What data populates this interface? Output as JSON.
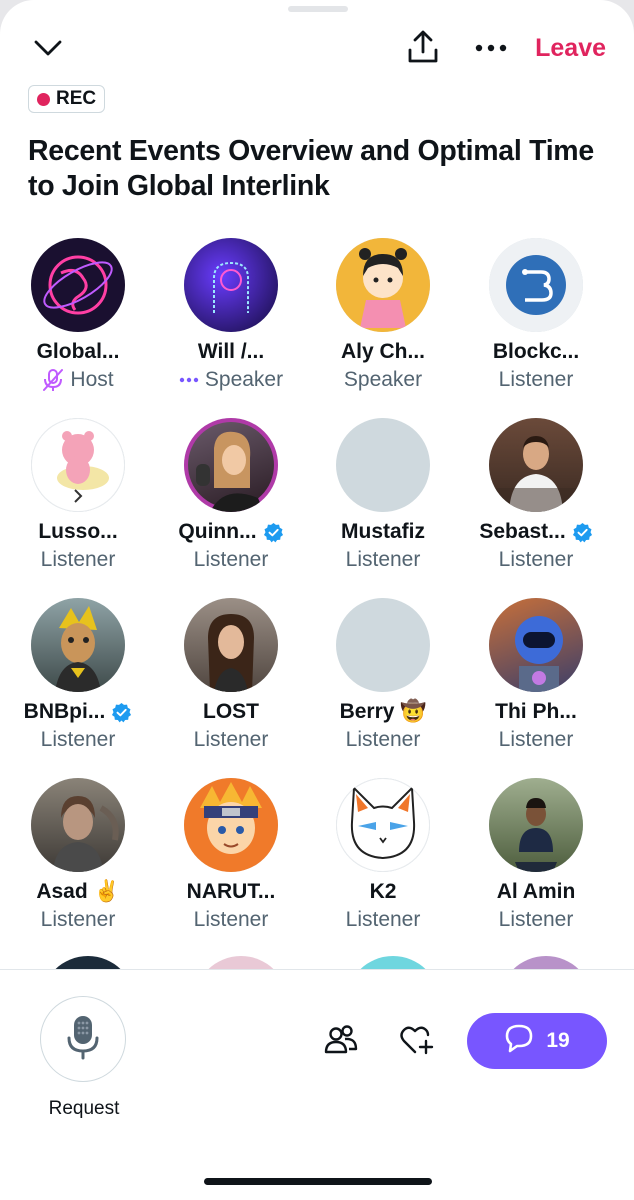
{
  "header": {
    "collapse_icon": "chevron-down-icon",
    "share_icon": "share-icon",
    "more_icon": "more-icon",
    "leave_label": "Leave"
  },
  "rec_badge": {
    "label": "REC",
    "color": "#e0245e"
  },
  "space": {
    "title": "Recent Events Overview and Optimal Time to Join Global Interlink"
  },
  "participants": [
    {
      "name": "Global...",
      "role": "Host",
      "role_icon": "mic-muted-icon",
      "verified": false
    },
    {
      "name": "Will /...",
      "role": "Speaker",
      "role_icon": "speaking-dots-icon",
      "verified": false
    },
    {
      "name": "Aly Ch...",
      "role": "Speaker",
      "verified": false
    },
    {
      "name": "Blockc...",
      "role": "Listener",
      "verified": false
    },
    {
      "name": "Lusso...",
      "role": "Listener",
      "verified": false
    },
    {
      "name": "Quinn...",
      "role": "Listener",
      "verified": true
    },
    {
      "name": "Mustafiz",
      "role": "Listener",
      "verified": false
    },
    {
      "name": "Sebast...",
      "role": "Listener",
      "verified": true
    },
    {
      "name": "BNBpi...",
      "role": "Listener",
      "verified": true
    },
    {
      "name": "LOST",
      "role": "Listener",
      "verified": false
    },
    {
      "name": "Berry 🤠",
      "role": "Listener",
      "verified": false
    },
    {
      "name": "Thi Ph...",
      "role": "Listener",
      "verified": false
    },
    {
      "name": "Asad ✌️",
      "role": "Listener",
      "verified": false
    },
    {
      "name": "NARUT...",
      "role": "Listener",
      "verified": false
    },
    {
      "name": "K2",
      "role": "Listener",
      "verified": false
    },
    {
      "name": "Al Amin",
      "role": "Listener",
      "verified": false
    }
  ],
  "bottom": {
    "request_label": "Request",
    "request_icon": "microphone-icon",
    "people_icon": "people-icon",
    "reaction_icon": "heart-plus-icon",
    "chat_icon": "chat-bubble-icon",
    "chat_count": "19"
  },
  "colors": {
    "accent": "#7856ff",
    "leave": "#e0245e",
    "verified": "#1d9bf0",
    "secondary_text": "#536471"
  }
}
